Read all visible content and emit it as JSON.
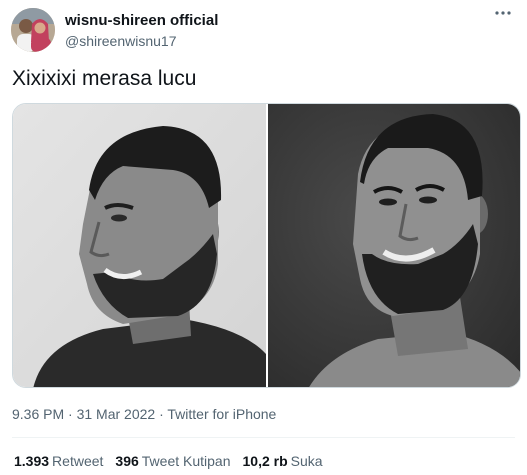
{
  "author": {
    "display_name": "wisnu-shireen official",
    "handle": "@shireenwisnu17"
  },
  "tweet": {
    "text": "Xixixixi merasa lucu"
  },
  "meta": {
    "time": "9.36 PM",
    "separator1": " · ",
    "date": "31 Mar 2022",
    "separator2": " · ",
    "source": "Twitter for iPhone"
  },
  "stats": {
    "retweets_count": "1.393",
    "retweets_label": "Retweet",
    "quotes_count": "396",
    "quotes_label": "Tweet Kutipan",
    "likes_count": "10,2 rb",
    "likes_label": "Suka"
  },
  "icons": {
    "more": "more-horizontal-icon"
  },
  "colors": {
    "text_primary": "#0f1419",
    "text_secondary": "#536471",
    "border": "#cfd9de"
  }
}
